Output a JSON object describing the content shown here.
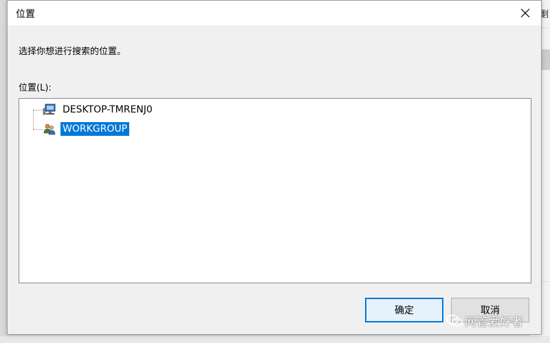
{
  "dialog": {
    "title": "位置",
    "close_symbol": "✕",
    "instruction": "选择你想进行搜索的位置。",
    "list_label": "位置(L):",
    "tree_items": [
      {
        "label": "DESKTOP-TMRENJ0",
        "icon": "computer-icon",
        "selected": false
      },
      {
        "label": "WORKGROUP",
        "icon": "workgroup-icon",
        "selected": true
      }
    ],
    "ok_label": "确定",
    "cancel_label": "取消"
  },
  "background_window": {
    "partial_char": "劐"
  },
  "watermark": {
    "text": "网管爱好者",
    "icon": "wechat-icon"
  },
  "colors": {
    "selection": "#0078d7",
    "dialog_bg": "#f0f0f0",
    "titlebar_bg": "#ffffff"
  }
}
